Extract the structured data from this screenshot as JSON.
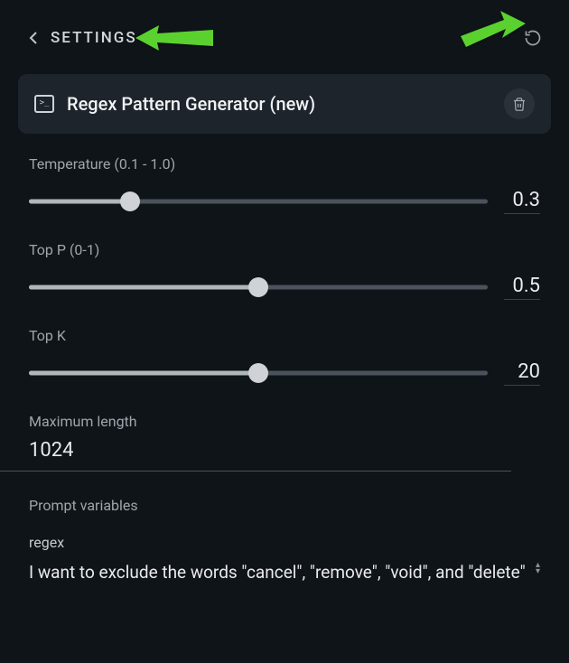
{
  "header": {
    "title": "SETTINGS"
  },
  "preset": {
    "title": "Regex Pattern Generator (new)"
  },
  "params": {
    "temperature": {
      "label": "Temperature (0.1 - 1.0)",
      "value": "0.3",
      "fraction": 0.22
    },
    "top_p": {
      "label": "Top P (0-1)",
      "value": "0.5",
      "fraction": 0.5
    },
    "top_k": {
      "label": "Top K",
      "value": "20",
      "fraction": 0.5
    },
    "max_length": {
      "label": "Maximum length",
      "value": "1024"
    }
  },
  "prompt_vars": {
    "section_label": "Prompt variables",
    "items": [
      {
        "name": "regex",
        "value": "I want to exclude the words \"cancel\", \"remove\", \"void\", and \"delete\""
      }
    ]
  }
}
